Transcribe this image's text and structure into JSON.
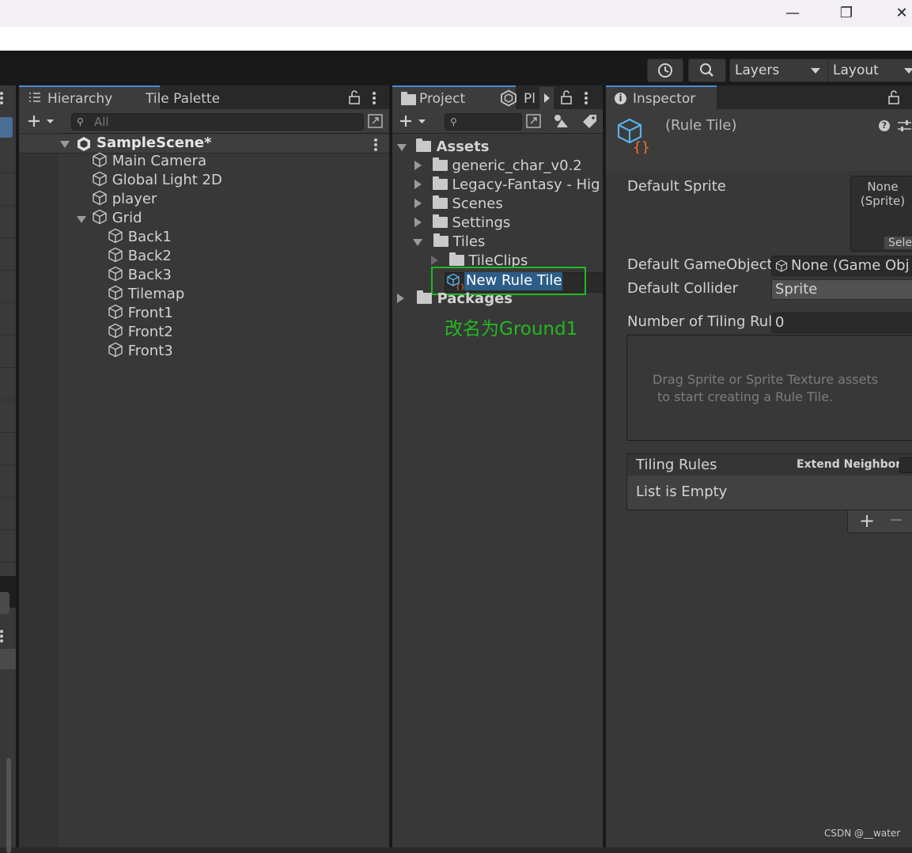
{
  "window": {
    "minimize_glyph": "—",
    "restore_glyph": "❐",
    "close_glyph": "✕"
  },
  "toolbar": {
    "layers_label": "Layers",
    "layout_label": "Layout"
  },
  "hierarchy": {
    "tab_label": "Hierarchy",
    "tile_palette_tab": "Tile Palette",
    "search_placeholder": "All",
    "scene_name": "SampleScene*",
    "items": [
      "Main Camera",
      "Global Light 2D",
      "player",
      "Grid",
      "Back1",
      "Back2",
      "Back3",
      "Tilemap",
      "Front1",
      "Front2",
      "Front3"
    ]
  },
  "project": {
    "tab_label": "Project",
    "tab2_label": "Pl",
    "tree": {
      "assets": "Assets",
      "generic_char": "generic_char_v0.2",
      "legacy_fantasy": "Legacy-Fantasy - Hig",
      "scenes": "Scenes",
      "settings": "Settings",
      "tiles": "Tiles",
      "tileclips": "TileClips",
      "new_rule_tile": "New Rule Tile",
      "packages": "Packages"
    },
    "annotation": "改名为Ground1"
  },
  "inspector": {
    "tab_label": "Inspector",
    "header_title": "(Rule Tile)",
    "default_sprite_label": "Default Sprite",
    "sprite_none": "None",
    "sprite_type": "(Sprite)",
    "sprite_select": "Sele",
    "default_gameobject_label": "Default GameObject",
    "default_gameobject_value": "None (Game Obj",
    "default_collider_label": "Default Collider",
    "default_collider_value": "Sprite",
    "tiling_count_label": "Number of Tiling Rul",
    "tiling_count_value": "0",
    "drop_hint_line1": "Drag Sprite or Sprite Texture assets",
    "drop_hint_line2": "to start creating a Rule Tile.",
    "tiling_rules_label": "Tiling Rules",
    "extend_neighbor_label": "Extend Neighbor",
    "list_empty": "List is Empty",
    "add_glyph": "+",
    "remove_glyph": "−"
  },
  "watermark": "CSDN @__water",
  "colors": {
    "accent": "#4a8cd8",
    "selection": "#2c5d87",
    "annotation_green": "#22b822",
    "tile_orange": "#f07030",
    "tile_blue": "#4aa8e0"
  }
}
